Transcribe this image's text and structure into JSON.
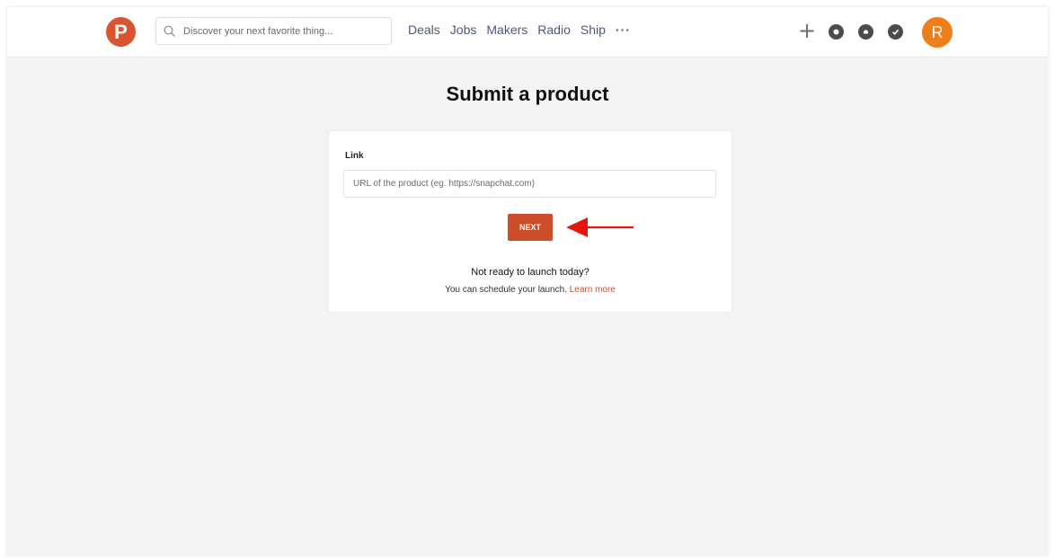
{
  "header": {
    "logo_letter": "P",
    "search_placeholder": "Discover your next favorite thing...",
    "nav": [
      "Deals",
      "Jobs",
      "Makers",
      "Radio",
      "Ship"
    ],
    "more_label": "···",
    "plus_label": "+",
    "icons": [
      "chat-icon",
      "bell-icon",
      "check-icon"
    ],
    "avatar_letter": "R",
    "brand_color": "#da552f",
    "avatar_color": "#ef7d1a"
  },
  "main": {
    "title": "Submit a product",
    "link_label": "Link",
    "url_placeholder": "URL of the product (eg. https://snapchat.com)",
    "url_value": "",
    "next_label": "NEXT",
    "not_ready": "Not ready to launch today?",
    "schedule_text": "You can schedule your launch. ",
    "learn_more": "Learn more",
    "annotation": "red-arrow-pointing-left",
    "annotation_color": "#e8150c"
  }
}
